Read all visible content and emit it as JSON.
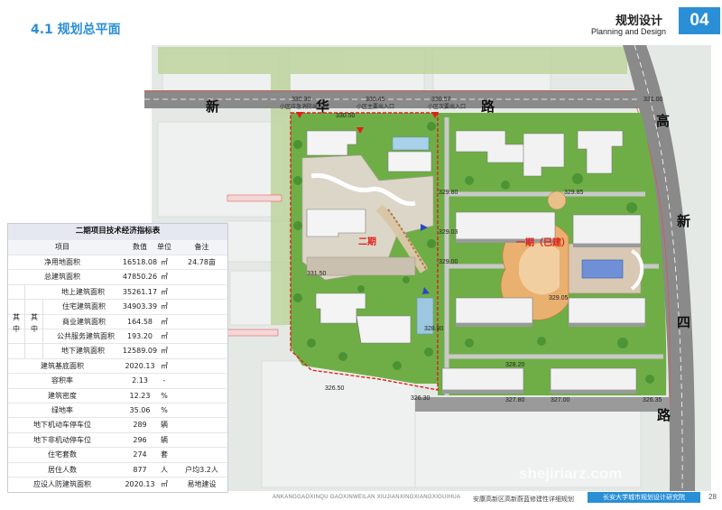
{
  "header": {
    "section_title": "4.1 规划总平面",
    "title_cn": "规划设计",
    "title_en": "Planning and Design",
    "page_badge": "04"
  },
  "plan": {
    "roads": {
      "north_chars": [
        "新",
        "华",
        "路"
      ],
      "east_chars": [
        "高",
        "新",
        "四",
        "路"
      ]
    },
    "phase2_label": "二期",
    "phase1_label": "一期（已建）",
    "entrances": [
      "小区应急消防出入口",
      "小区主要出入口",
      "小区次要出入口"
    ],
    "elevations": [
      "330.30",
      "330.45",
      "330.57",
      "331.00",
      "330.50",
      "329.80",
      "329.85",
      "329.03",
      "329.00",
      "329.05",
      "331.50",
      "328.80",
      "328.20",
      "327.80",
      "326.30",
      "326.50",
      "326.35",
      "327.00"
    ],
    "watermark": "shejiriarz.com",
    "colors": {
      "boundary": "#e0201a",
      "accent": "#2a8fd6",
      "grass": "#6fb04a"
    }
  },
  "table": {
    "caption": "二期项目技术经济指标表",
    "header": [
      "项目",
      "数值",
      "单位",
      "备注"
    ],
    "group_outer": "其中",
    "group_inner": "其中",
    "rows": [
      {
        "name": "净用地面积",
        "value": "16518.08",
        "unit": "㎡",
        "note": "24.78亩"
      },
      {
        "name": "总建筑面积",
        "value": "47850.26",
        "unit": "㎡",
        "note": ""
      },
      {
        "name": "地上建筑面积",
        "value": "35261.17",
        "unit": "㎡",
        "note": ""
      },
      {
        "name": "住宅建筑面积",
        "value": "34903.39",
        "unit": "㎡",
        "note": ""
      },
      {
        "name": "商业建筑面积",
        "value": "164.58",
        "unit": "㎡",
        "note": ""
      },
      {
        "name": "公共服务建筑面积",
        "value": "193.20",
        "unit": "㎡",
        "note": ""
      },
      {
        "name": "地下建筑面积",
        "value": "12589.09",
        "unit": "㎡",
        "note": ""
      },
      {
        "name": "建筑基底面积",
        "value": "2020.13",
        "unit": "㎡",
        "note": ""
      },
      {
        "name": "容积率",
        "value": "2.13",
        "unit": "-",
        "note": ""
      },
      {
        "name": "建筑密度",
        "value": "12.23",
        "unit": "%",
        "note": ""
      },
      {
        "name": "绿地率",
        "value": "35.06",
        "unit": "%",
        "note": ""
      },
      {
        "name": "地下机动车停车位",
        "value": "289",
        "unit": "辆",
        "note": ""
      },
      {
        "name": "地下非机动停车位",
        "value": "296",
        "unit": "辆",
        "note": ""
      },
      {
        "name": "住宅套数",
        "value": "274",
        "unit": "套",
        "note": ""
      },
      {
        "name": "居住人数",
        "value": "877",
        "unit": "人",
        "note": "户均3.2人"
      },
      {
        "name": "应设人防建筑面积",
        "value": "2020.13",
        "unit": "㎡",
        "note": "易地建设"
      }
    ]
  },
  "footer": {
    "pinyin": "ANKANGGAOXINQU  GAOXINWEILAN  XIUJIANXINGXIANGXIGUIHUA",
    "project": "安康高新区高新蔚蓝修建性详细规划",
    "institute": "长安大学城市规划设计研究院",
    "page": "28"
  }
}
